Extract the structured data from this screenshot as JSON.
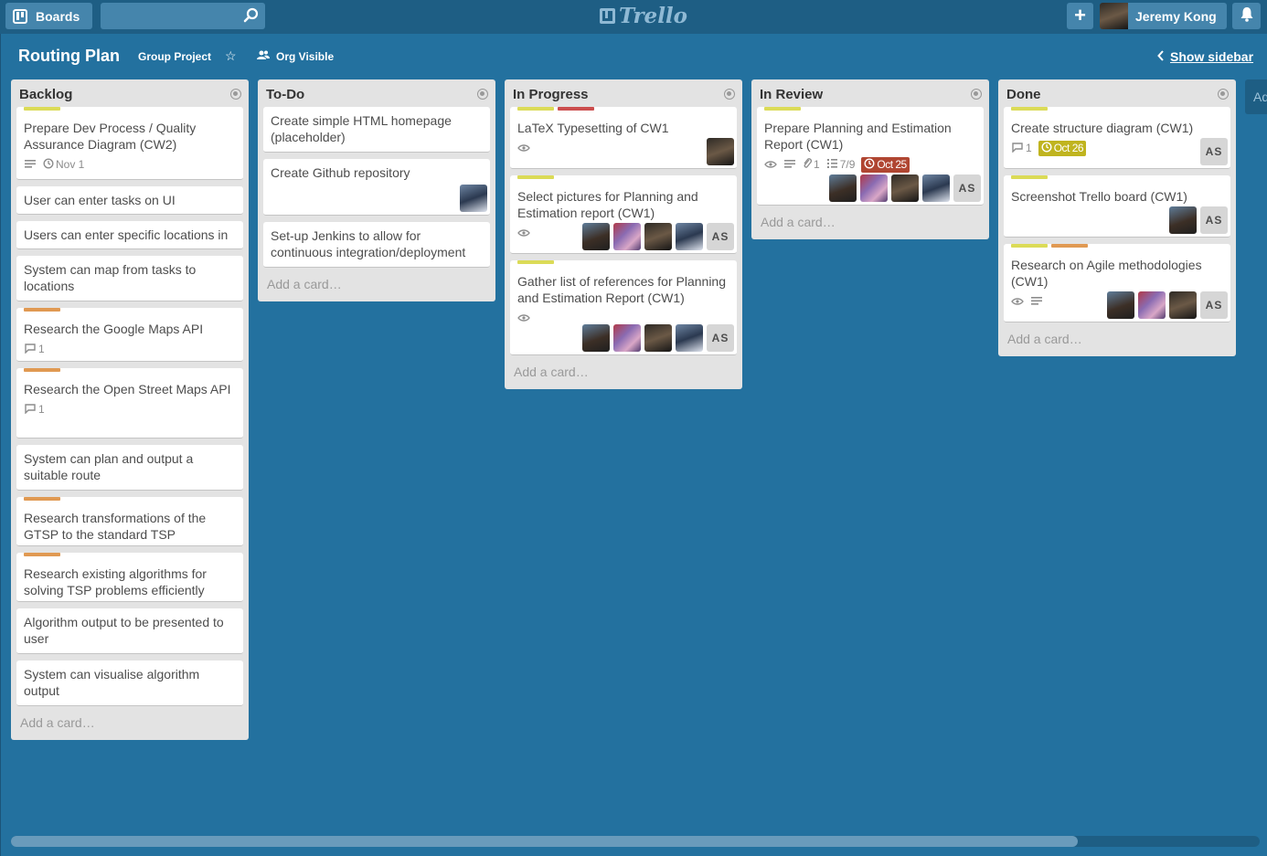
{
  "header": {
    "boards_label": "Boards",
    "logo_text": "Trello",
    "user_name": "Jeremy Kong"
  },
  "board": {
    "title": "Routing Plan",
    "org": "Group Project",
    "visibility": "Org Visible",
    "show_sidebar": "Show sidebar",
    "next_list_peek": "Ad"
  },
  "add_card_label": "Add a card…",
  "colors": {
    "background": "#23719f",
    "header": "#1e5e84",
    "label_yellow": "#dbdb57",
    "label_orange": "#e09952",
    "label_red": "#cb4d4d",
    "due_overdue": "#b04632",
    "due_done": "#c0b41f"
  },
  "lists": [
    {
      "title": "Backlog",
      "cards": [
        {
          "title": "Prepare Dev Process / Quality Assurance Diagram (CW2)",
          "labels": [
            "yellow"
          ],
          "badges": {
            "description": true,
            "due": {
              "text": "Nov 1",
              "status": "plain"
            }
          },
          "members": []
        },
        {
          "title": "User can enter tasks on UI",
          "labels": [],
          "badges": {},
          "members": []
        },
        {
          "title": "Users can enter specific locations in",
          "labels": [],
          "badges": {},
          "members": []
        },
        {
          "title": "System can map from tasks to locations",
          "labels": [],
          "badges": {},
          "members": []
        },
        {
          "title": "Research the Google Maps API",
          "labels": [
            "orange"
          ],
          "badges": {
            "comments": "1"
          },
          "members": []
        },
        {
          "title": "Research the Open Street Maps API",
          "labels": [
            "orange"
          ],
          "badges": {
            "comments": "1"
          },
          "members": []
        },
        {
          "title": "System can plan and output a suitable route",
          "labels": [],
          "badges": {},
          "members": []
        },
        {
          "title": "Research transformations of the GTSP to the standard TSP",
          "labels": [
            "orange"
          ],
          "badges": {},
          "members": []
        },
        {
          "title": "Research existing algorithms for solving TSP problems efficiently",
          "labels": [
            "orange"
          ],
          "badges": {},
          "members": []
        },
        {
          "title": "Algorithm output to be presented to user",
          "labels": [],
          "badges": {},
          "members": []
        },
        {
          "title": "System can visualise algorithm output",
          "labels": [],
          "badges": {},
          "members": []
        }
      ]
    },
    {
      "title": "To-Do",
      "cards": [
        {
          "title": "Create simple HTML homepage (placeholder)",
          "labels": [],
          "badges": {},
          "members": []
        },
        {
          "title": "Create Github repository",
          "labels": [],
          "badges": {},
          "members": [
            "a4"
          ]
        },
        {
          "title": "Set-up Jenkins to allow for continuous integration/deployment",
          "labels": [],
          "badges": {},
          "members": []
        }
      ]
    },
    {
      "title": "In Progress",
      "cards": [
        {
          "title": "LaTeX Typesetting of CW1",
          "labels": [
            "yellow",
            "red"
          ],
          "badges": {
            "watch": true
          },
          "members": [
            "a3"
          ]
        },
        {
          "title": "Select pictures for Planning and Estimation report (CW1)",
          "labels": [
            "yellow"
          ],
          "badges": {
            "watch": true
          },
          "members": [
            "a1",
            "a2",
            "a3",
            "a4",
            "as"
          ]
        },
        {
          "title": "Gather list of references for Planning and Estimation Report (CW1)",
          "labels": [
            "yellow"
          ],
          "badges": {
            "watch": true
          },
          "members": [
            "a1",
            "a2",
            "a3",
            "a4",
            "as"
          ]
        }
      ]
    },
    {
      "title": "In Review",
      "cards": [
        {
          "title": "Prepare Planning and Estimation Report (CW1)",
          "labels": [
            "yellow"
          ],
          "badges": {
            "watch": true,
            "description": true,
            "attachments": "1",
            "checklist": "7/9",
            "due": {
              "text": "Oct 25",
              "status": "red"
            }
          },
          "members": [
            "a1",
            "a2",
            "a3",
            "a4",
            "as"
          ]
        }
      ]
    },
    {
      "title": "Done",
      "cards": [
        {
          "title": "Create structure diagram (CW1)",
          "labels": [
            "yellow"
          ],
          "badges": {
            "comments": "1",
            "due": {
              "text": "Oct 26",
              "status": "yellow"
            }
          },
          "members": [
            "as"
          ]
        },
        {
          "title": "Screenshot Trello board (CW1)",
          "labels": [
            "yellow"
          ],
          "badges": {},
          "members": [
            "a1",
            "as"
          ]
        },
        {
          "title": "Research on Agile methodologies (CW1)",
          "labels": [
            "yellow",
            "orange"
          ],
          "badges": {
            "watch": true,
            "description": true
          },
          "members": [
            "a1",
            "a2",
            "a3",
            "as"
          ]
        }
      ]
    }
  ],
  "avatar_initials": "AS"
}
